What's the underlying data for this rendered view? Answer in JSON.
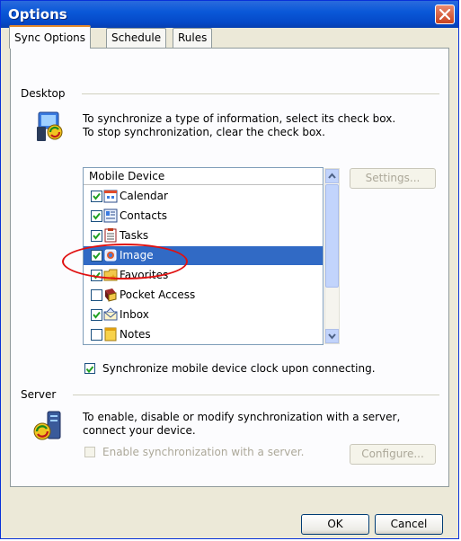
{
  "window": {
    "title": "Options"
  },
  "tabs": [
    {
      "label": "Sync Options"
    },
    {
      "label": "Schedule"
    },
    {
      "label": "Rules"
    }
  ],
  "desktop": {
    "heading": "Desktop",
    "info_line1": "To synchronize a type of information, select its check box.",
    "info_line2": "To stop synchronization, clear the check box.",
    "list_header": "Mobile Device",
    "items": [
      {
        "label": "Calendar",
        "checked": true,
        "icon": "calendar-icon"
      },
      {
        "label": "Contacts",
        "checked": true,
        "icon": "contacts-icon"
      },
      {
        "label": "Tasks",
        "checked": true,
        "icon": "tasks-icon"
      },
      {
        "label": "Image",
        "checked": true,
        "icon": "image-icon",
        "selected": true
      },
      {
        "label": "Favorites",
        "checked": true,
        "icon": "favorites-icon"
      },
      {
        "label": "Pocket Access",
        "checked": false,
        "icon": "pocket-access-icon"
      },
      {
        "label": "Inbox",
        "checked": true,
        "icon": "inbox-icon"
      },
      {
        "label": "Notes",
        "checked": false,
        "icon": "notes-icon"
      }
    ],
    "settings_button": "Settings...",
    "clock_sync_label": "Synchronize mobile device clock upon connecting.",
    "clock_sync_checked": true
  },
  "server": {
    "heading": "Server",
    "info_line1": "To enable, disable or modify synchronization with a server,",
    "info_line2": "connect your device.",
    "enable_label": "Enable synchronization with a server.",
    "enable_checked": false,
    "configure_button": "Configure..."
  },
  "footer": {
    "ok_button": "OK",
    "cancel_button": "Cancel"
  }
}
